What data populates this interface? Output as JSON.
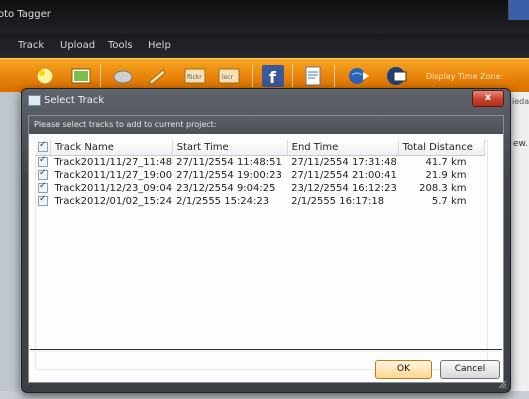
{
  "app": {
    "title": "oto Tagger",
    "menu": [
      "Track",
      "Upload",
      "Tools",
      "Help"
    ],
    "toolbar_icons": [
      "new-project-icon",
      "open-photos-icon",
      "gps-device-icon",
      "geotag-icon",
      "flickr-icon",
      "locr-icon",
      "facebook-icon",
      "export-icon",
      "google-earth-icon",
      "web-gallery-icon"
    ],
    "display_time_zone_label": "Display Time Zone:",
    "right_edge_text_top": "ieda",
    "right_edge_text_mid": "ew."
  },
  "dialog": {
    "title": "Select Track",
    "prompt": "Please select tracks to add to current project:",
    "columns": [
      "Track Name",
      "Start Time",
      "End Time",
      "Total Distance"
    ],
    "rows": [
      {
        "checked": true,
        "name": "Track2011/11/27_11:48",
        "start": "27/11/2554 11:48:51",
        "end": "27/11/2554 17:31:48",
        "distance": "41.7 km"
      },
      {
        "checked": true,
        "name": "Track2011/11/27_19:00",
        "start": "27/11/2554 19:00:23",
        "end": "27/11/2554 21:00:41",
        "distance": "21.9 km"
      },
      {
        "checked": true,
        "name": "Track2011/12/23_09:04",
        "start": "23/12/2554 9:04:25",
        "end": "23/12/2554 16:12:23",
        "distance": "208.3 km"
      },
      {
        "checked": true,
        "name": "Track2012/01/02_15:24",
        "start": "2/1/2555 15:24:23",
        "end": "2/1/2555 16:17:18",
        "distance": "5.7 km"
      }
    ],
    "ok_label": "OK",
    "cancel_label": "Cancel",
    "close_glyph": "x"
  },
  "colors": {
    "toolbar_orange": "#e8820a",
    "dialog_frame": "#3f444a",
    "ok_button": "#ffd58e"
  }
}
